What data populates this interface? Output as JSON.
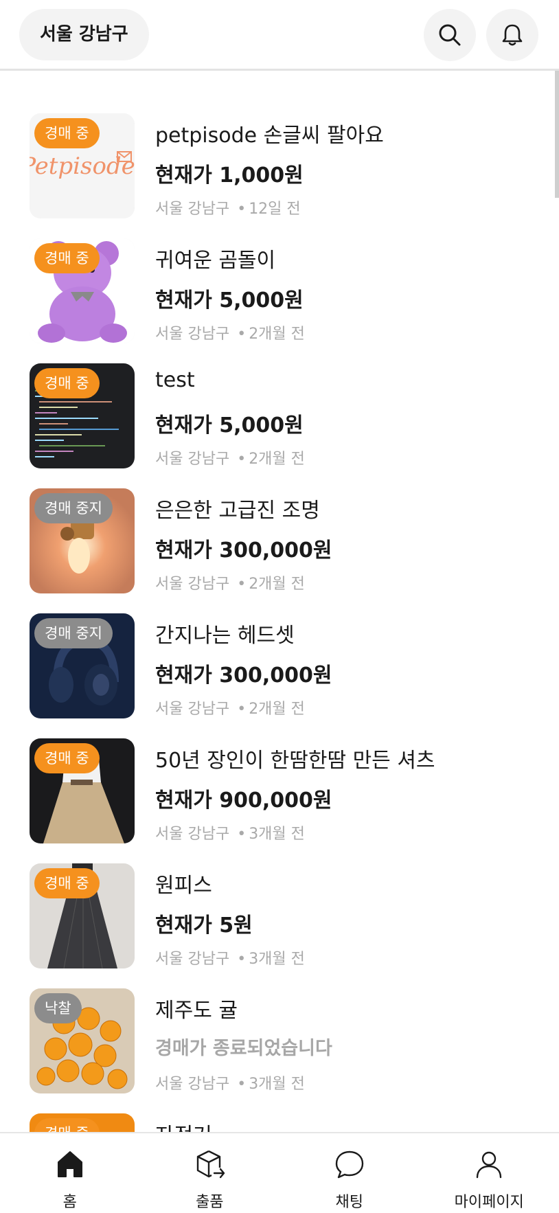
{
  "header": {
    "location": "서울 강남구"
  },
  "items": [
    {
      "title": "petpisode 손글씨 팔아요",
      "price": "현재가 1,000원",
      "location": "서울 강남구",
      "sep": "•",
      "time": "12일 전",
      "status": "경매 중",
      "thumb_logo": "Petpisode"
    },
    {
      "title": "귀여운 곰돌이",
      "price": "현재가 5,000원",
      "location": "서울 강남구",
      "sep": "•",
      "time": "2개월 전",
      "status": "경매 중"
    },
    {
      "title": "test",
      "price": "현재가 5,000원",
      "location": "서울 강남구",
      "sep": "•",
      "time": "2개월 전",
      "status": "경매 중"
    },
    {
      "title": "은은한 고급진 조명",
      "price": "현재가 300,000원",
      "location": "서울 강남구",
      "sep": "•",
      "time": "2개월 전",
      "status": "경매 중지"
    },
    {
      "title": "간지나는 헤드셋",
      "price": "현재가 300,000원",
      "location": "서울 강남구",
      "sep": "•",
      "time": "2개월 전",
      "status": "경매 중지"
    },
    {
      "title": "50년 장인이 한땀한땀 만든 셔츠",
      "price": "현재가 900,000원",
      "location": "서울 강남구",
      "sep": "•",
      "time": "3개월 전",
      "status": "경매 중"
    },
    {
      "title": "원피스",
      "price": "현재가 5원",
      "location": "서울 강남구",
      "sep": "•",
      "time": "3개월 전",
      "status": "경매 중"
    },
    {
      "title": "제주도 귤",
      "price": "경매가 종료되었습니다",
      "location": "서울 강남구",
      "sep": "•",
      "time": "3개월 전",
      "status": "낙찰"
    },
    {
      "title": "자전거",
      "price": "",
      "location": "",
      "sep": "",
      "time": "",
      "status": "경매 중"
    }
  ],
  "nav": [
    {
      "label": "홈",
      "icon": "home-icon"
    },
    {
      "label": "출품",
      "icon": "box-arrow-icon"
    },
    {
      "label": "채팅",
      "icon": "chat-bubble-icon"
    },
    {
      "label": "마이페이지",
      "icon": "person-icon"
    }
  ],
  "colors": {
    "active_badge": "#f5911e",
    "stopped_badge": "#8c8c8c",
    "muted_text": "#a9a9a9"
  }
}
